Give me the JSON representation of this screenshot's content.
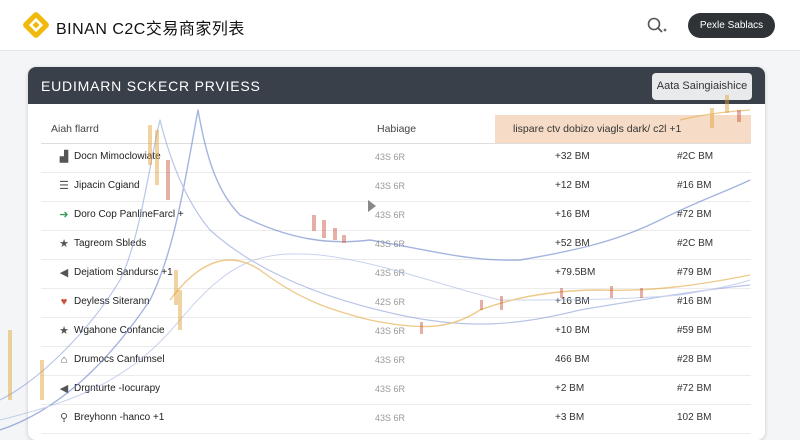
{
  "topbar": {
    "brand": "BINAN C2C交易商家列表",
    "logo_icon": "diamond-logo-icon",
    "search_icon": "search-icon",
    "button_label": "Pexle Sablacs"
  },
  "card": {
    "title": "EUDIMARN SCKECR PRVIESS",
    "button_label": "Aata Saingiaishice"
  },
  "table": {
    "headers": [
      "Aiah flarrd",
      "Habiage",
      "lispare ctv dobizo viagls dark/ c2l +1"
    ],
    "rows": [
      {
        "icon": "chart-bar-icon",
        "icon_glyph": "▟",
        "name": "Docn Mimoclowiate",
        "blur": "43S 6R",
        "c3": "+32 BM",
        "c4": "#2C BM"
      },
      {
        "icon": "menu-icon",
        "icon_glyph": "☰",
        "name": "Jipacin Cgiand",
        "blur": "43S 6R",
        "c3": "+12 BM",
        "c4": "#16 BM"
      },
      {
        "icon": "arrow-icon",
        "icon_glyph": "➜",
        "name": "Doro Cop PanlineFarcl +",
        "blur": "43S 6R",
        "c3": "+16 BM",
        "c4": "#72 BM"
      },
      {
        "icon": "star-icon",
        "icon_glyph": "★",
        "name": "Tagreom Sbleds",
        "blur": "43S 6R",
        "c3": "+52 BM",
        "c4": "#2C BM"
      },
      {
        "icon": "send-icon",
        "icon_glyph": "◀",
        "name": "Dejatiom Sandursc +1",
        "blur": "43S 6R",
        "c3": "+79.5BM",
        "c4": "#79 BM"
      },
      {
        "icon": "heart-icon",
        "icon_glyph": "♥",
        "name": "Deyless Siterann",
        "blur": "42S 6R",
        "c3": "+16 BM",
        "c4": "#16 BM"
      },
      {
        "icon": "star-icon",
        "icon_glyph": "★",
        "name": "Wgahone Confancie",
        "blur": "43S 6R",
        "c3": "+10 BM",
        "c4": "#59 BM"
      },
      {
        "icon": "home-icon",
        "icon_glyph": "⌂",
        "name": "Drumocs Canfumsel",
        "blur": "43S 6R",
        "c3": "466 BM",
        "c4": "#28 BM"
      },
      {
        "icon": "arrow-left-icon",
        "icon_glyph": "◀",
        "name": "Drgnturte -Iocurapy",
        "blur": "43S 6R",
        "c3": "+2 BM",
        "c4": "#72 BM"
      },
      {
        "icon": "pin-icon",
        "icon_glyph": "⚲",
        "name": "Breyhonn -hanco +1",
        "blur": "43S 6R",
        "c3": "+3 BM",
        "c4": "102 BM"
      }
    ]
  },
  "colors": {
    "accent": "#f0b90b",
    "header_dark": "#3a4049",
    "highlight": "#f6dcc6",
    "line_blue": "#5b78c4",
    "line_orange": "#e0a030",
    "candle_red": "#c9503c"
  }
}
